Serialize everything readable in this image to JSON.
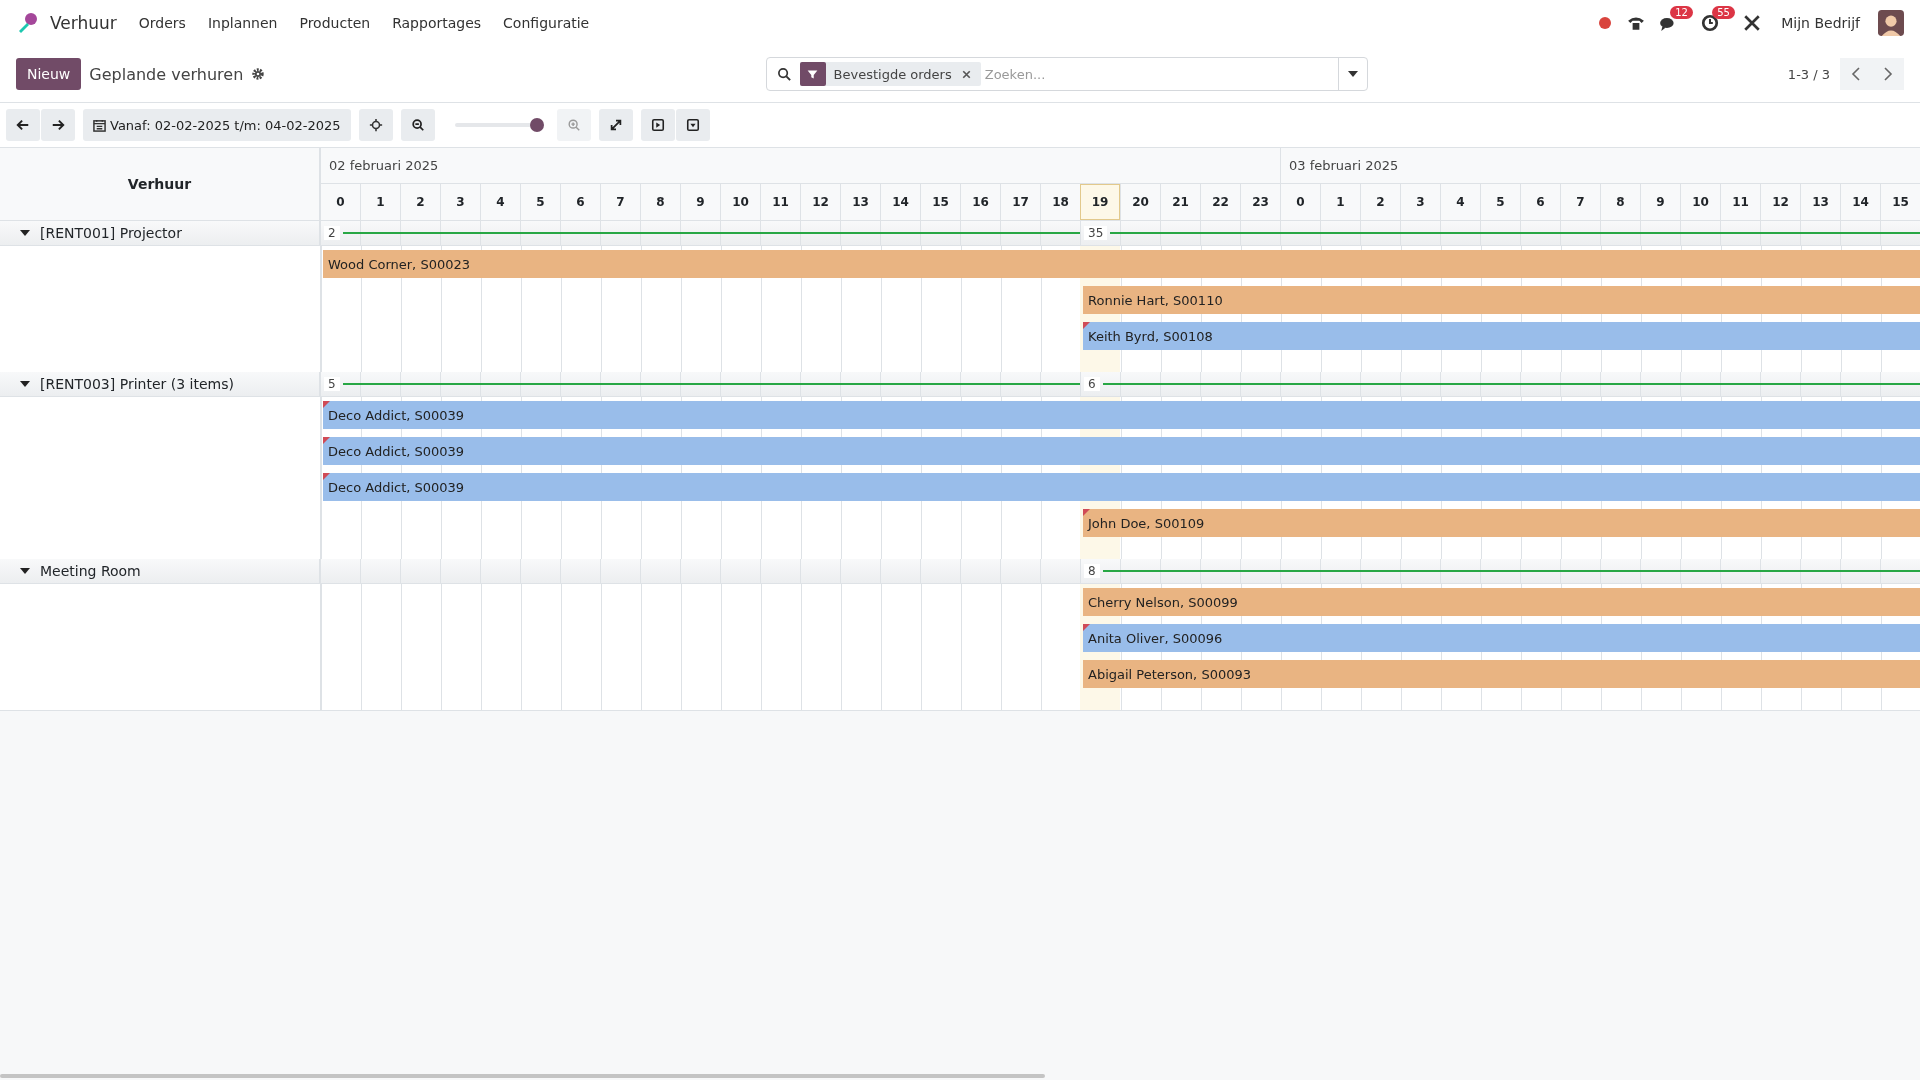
{
  "app": {
    "name": "Verhuur"
  },
  "menu": [
    "Orders",
    "Inplannen",
    "Producten",
    "Rapportages",
    "Configuratie"
  ],
  "systray": {
    "chat_count": "12",
    "activity_count": "55",
    "company": "Mijn Bedrijf"
  },
  "control": {
    "new_button": "Nieuw",
    "title": "Geplande verhuren",
    "facets": [
      {
        "label": "Bevestigde orders"
      }
    ],
    "placeholder": "Zoeken...",
    "pager": "1-3 / 3"
  },
  "toolbar": {
    "range": "Vanaf: 02-02-2025 t/m: 04-02-2025",
    "zoom": {
      "level": 1
    }
  },
  "gantt": {
    "row_header": "Verhuur",
    "days": [
      {
        "label": "02 februari 2025",
        "hours": [
          {
            "label": "0",
            "selected": false
          },
          {
            "label": "1",
            "selected": false
          },
          {
            "label": "2",
            "selected": false
          },
          {
            "label": "3",
            "selected": false
          },
          {
            "label": "4",
            "selected": false
          },
          {
            "label": "5",
            "selected": false
          },
          {
            "label": "6",
            "selected": false
          },
          {
            "label": "7",
            "selected": false
          },
          {
            "label": "8",
            "selected": false
          },
          {
            "label": "9",
            "selected": false
          },
          {
            "label": "10",
            "selected": false
          },
          {
            "label": "11",
            "selected": false
          },
          {
            "label": "12",
            "selected": false
          },
          {
            "label": "13",
            "selected": false
          },
          {
            "label": "14",
            "selected": false
          },
          {
            "label": "15",
            "selected": false
          },
          {
            "label": "16",
            "selected": false
          },
          {
            "label": "17",
            "selected": false
          },
          {
            "label": "18",
            "selected": false
          },
          {
            "label": "19",
            "selected": true
          },
          {
            "label": "20",
            "selected": false
          },
          {
            "label": "21",
            "selected": false
          },
          {
            "label": "22",
            "selected": false
          },
          {
            "label": "23",
            "selected": false
          }
        ]
      },
      {
        "label": "03 februari 2025",
        "hours": [
          {
            "label": "0",
            "selected": false
          },
          {
            "label": "1",
            "selected": false
          },
          {
            "label": "2",
            "selected": false
          },
          {
            "label": "3",
            "selected": false
          },
          {
            "label": "4",
            "selected": false
          },
          {
            "label": "5",
            "selected": false
          },
          {
            "label": "6",
            "selected": false
          },
          {
            "label": "7",
            "selected": false
          },
          {
            "label": "8",
            "selected": false
          },
          {
            "label": "9",
            "selected": false
          },
          {
            "label": "10",
            "selected": false
          },
          {
            "label": "11",
            "selected": false
          },
          {
            "label": "12",
            "selected": false
          },
          {
            "label": "13",
            "selected": false
          },
          {
            "label": "14",
            "selected": false
          },
          {
            "label": "15",
            "selected": false
          }
        ]
      }
    ],
    "groups": [
      {
        "name": "[RENT001] Projector",
        "expanded": true,
        "totals": {
          "before_now": "2",
          "from_now": "35"
        },
        "pills": [
          {
            "label": "Wood Corner, S00023",
            "from_now": false,
            "color": "#e9b482",
            "warning": false
          },
          {
            "label": "Ronnie Hart, S00110",
            "from_now": true,
            "color": "#e9b482",
            "warning": false
          },
          {
            "label": "Keith Byrd, S00108",
            "from_now": true,
            "color": "#99bdea",
            "warning": true
          }
        ]
      },
      {
        "name": "[RENT003] Printer (3 items)",
        "expanded": true,
        "totals": {
          "before_now": "5",
          "from_now": "6"
        },
        "pills": [
          {
            "label": "Deco Addict, S00039",
            "from_now": false,
            "color": "#99bdea",
            "warning": true
          },
          {
            "label": "Deco Addict, S00039",
            "from_now": false,
            "color": "#99bdea",
            "warning": true
          },
          {
            "label": "Deco Addict, S00039",
            "from_now": false,
            "color": "#99bdea",
            "warning": true
          },
          {
            "label": "John Doe, S00109",
            "from_now": true,
            "color": "#e9b482",
            "warning": true
          }
        ]
      },
      {
        "name": "Meeting Room",
        "expanded": true,
        "totals": {
          "from_now": "8"
        },
        "pills": [
          {
            "label": "Cherry Nelson, S00099",
            "from_now": true,
            "color": "#e9b482",
            "warning": false
          },
          {
            "label": "Anita Oliver, S00096",
            "from_now": true,
            "color": "#99bdea",
            "warning": true
          },
          {
            "label": "Abigail Peterson, S00093",
            "from_now": true,
            "color": "#e9b482",
            "warning": false
          }
        ]
      }
    ]
  }
}
